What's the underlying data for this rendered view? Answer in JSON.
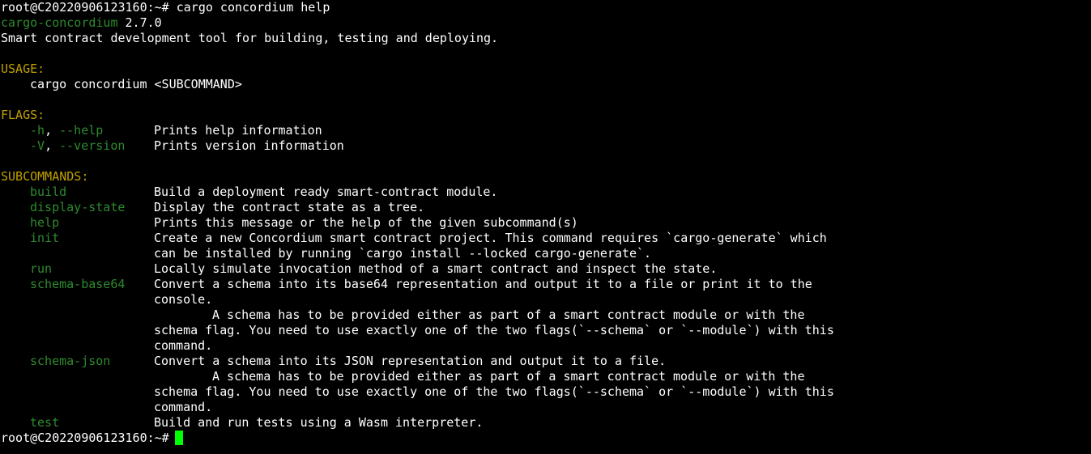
{
  "terminal": {
    "prompt": "root@C20220906123160:~#",
    "command": "cargo concordium help",
    "tool_name": "cargo-concordium",
    "version": "2.7.0",
    "description": "Smart contract development tool for building, testing and deploying.",
    "usage_header": "USAGE:",
    "usage_line": "cargo concordium <SUBCOMMAND>",
    "flags_header": "FLAGS:",
    "flags": [
      {
        "short": "-h",
        "sep": ", ",
        "long": "--help",
        "desc": "Prints help information"
      },
      {
        "short": "-V",
        "sep": ", ",
        "long": "--version",
        "desc": "Prints version information"
      }
    ],
    "subcommands_header": "SUBCOMMANDS:",
    "subcommands": [
      {
        "name": "build",
        "lines": [
          "Build a deployment ready smart-contract module."
        ]
      },
      {
        "name": "display-state",
        "lines": [
          "Display the contract state as a tree."
        ]
      },
      {
        "name": "help",
        "lines": [
          "Prints this message or the help of the given subcommand(s)"
        ]
      },
      {
        "name": "init",
        "lines": [
          "Create a new Concordium smart contract project. This command requires `cargo-generate` which",
          "can be installed by running `cargo install --locked cargo-generate`."
        ]
      },
      {
        "name": "run",
        "lines": [
          "Locally simulate invocation method of a smart contract and inspect the state."
        ]
      },
      {
        "name": "schema-base64",
        "lines": [
          "Convert a schema into its base64 representation and output it to a file or print it to the",
          "console."
        ],
        "extra": [
          "A schema has to be provided either as part of a smart contract module or with the"
        ],
        "extra_cont": [
          "schema flag. You need to use exactly one of the two flags(`--schema` or `--module`) with this",
          "command."
        ]
      },
      {
        "name": "schema-json",
        "lines": [
          "Convert a schema into its JSON representation and output it to a file."
        ],
        "extra": [
          "A schema has to be provided either as part of a smart contract module or with the"
        ],
        "extra_cont": [
          "schema flag. You need to use exactly one of the two flags(`--schema` or `--module`) with this",
          "command."
        ]
      },
      {
        "name": "test",
        "lines": [
          "Build and run tests using a Wasm interpreter."
        ]
      }
    ],
    "colors": {
      "background": "#000000",
      "text": "#ffffff",
      "green": "#2e8b2e",
      "yellow": "#c0a000",
      "cursor": "#00ff00"
    }
  }
}
